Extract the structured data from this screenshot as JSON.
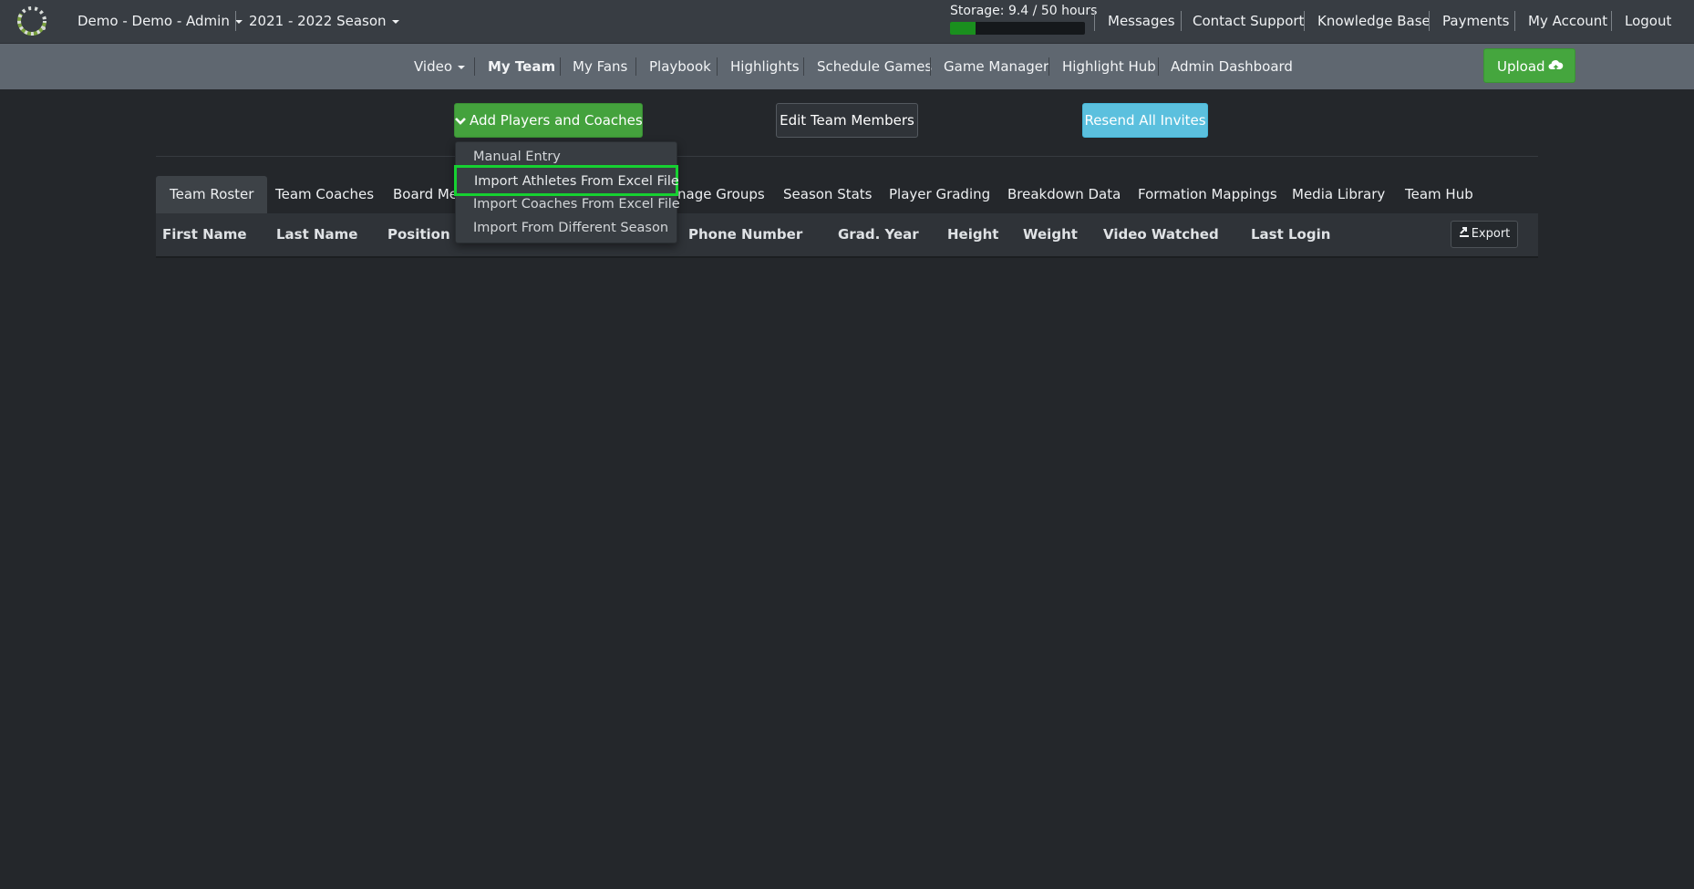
{
  "topbar": {
    "team": "Demo - Demo - Admin",
    "season": "2021 - 2022 Season",
    "storage": {
      "label": "Storage: 9.4 / 50 hours",
      "used": 9.4,
      "total": 50
    },
    "links": [
      "Messages",
      "Contact Support",
      "Knowledge Base",
      "Payments",
      "My Account",
      "Logout"
    ]
  },
  "nav": {
    "items": [
      "Video",
      "My Team",
      "My Fans",
      "Playbook",
      "Highlights",
      "Schedule Games",
      "Game Manager",
      "Highlight Hub",
      "Admin Dashboard"
    ],
    "active": "My Team",
    "upload_label": "Upload"
  },
  "actions": {
    "add_label": "Add Players and Coaches",
    "edit_label": "Edit Team Members",
    "resend_label": "Resend All Invites"
  },
  "dropdown": {
    "items": [
      "Manual Entry",
      "Import Athletes From Excel File",
      "Import Coaches From Excel File",
      "Import From Different Season"
    ],
    "highlighted": "Import Athletes From Excel File"
  },
  "tabs": {
    "items": [
      "Team Roster",
      "Team Coaches",
      "Board Members",
      "Manage Groups",
      "Season Stats",
      "Player Grading",
      "Breakdown Data",
      "Formation Mappings",
      "Media Library",
      "Team Hub"
    ],
    "visible": [
      "Team Roster",
      "Team Coaches",
      "Board Me",
      "nage Groups",
      "Season Stats",
      "Player Grading",
      "Breakdown Data",
      "Formation Mappings",
      "Media Library",
      "Team Hub"
    ],
    "active": "Team Roster"
  },
  "table": {
    "columns": [
      "First Name",
      "Last Name",
      "Position",
      "Phone Number",
      "Grad. Year",
      "Height",
      "Weight",
      "Video Watched",
      "Last Login"
    ],
    "export_label": "Export",
    "rows": []
  },
  "colors": {
    "accent_green": "#44a23d",
    "info_blue": "#5bc0de",
    "highlight_green": "#16d131",
    "storage_fill": "#1a8f1e"
  }
}
